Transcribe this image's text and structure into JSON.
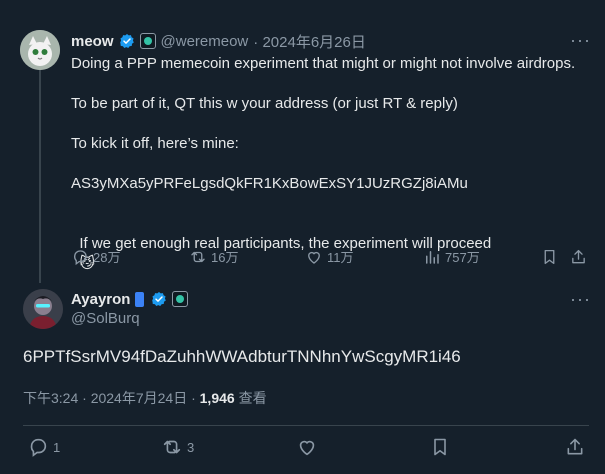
{
  "parent_tweet": {
    "display_name": "meow",
    "handle": "@weremeow",
    "date": "· 2024年6月26日",
    "lines": [
      "Doing a PPP memecoin experiment that might or might not involve airdrops.",
      "To be part of it, QT this w your address (or just RT & reply)",
      "To kick it off, here’s mine:",
      "AS3yMXa5yPRFeLgsdQkFR1KxBowExSY1JUzRGZj8iAMu",
      "If we get enough real participants, the experiment will proceed"
    ],
    "emoji": "😼",
    "stats": {
      "replies": "28万",
      "reposts": "16万",
      "likes": "11万",
      "views": "757万"
    }
  },
  "reply_tweet": {
    "display_name": "Ayayron",
    "handle": "@SolBurq",
    "text": "6PPTfSsrMV94fDaZuhhWWAdbturTNNhnYwScgyMR1i46",
    "time": "下午3:24 · 2024年7月24日 · ",
    "views_count": "1,946",
    "views_label": " 查看",
    "stats": {
      "replies": "1",
      "reposts": "3"
    }
  },
  "more_label": "···",
  "colors": {
    "background": "#15202b",
    "text": "#e7e9ea",
    "muted": "#8b98a5",
    "verified_blue": "#1d9bf0",
    "border": "#38444d"
  }
}
